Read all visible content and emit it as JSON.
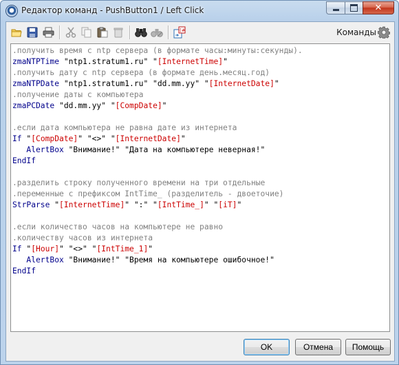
{
  "window": {
    "title": "Редактор команд - PushButton1 / Left Click"
  },
  "toolbar": {
    "icons": [
      "open-folder-icon",
      "save-icon",
      "print-icon",
      "cut-icon",
      "copy-icon",
      "paste-icon",
      "delete-icon",
      "find-icon",
      "find-next-icon",
      "insert-variable-icon"
    ],
    "commands_label": "Команды",
    "commands_icon": "gear-icon"
  },
  "editor": {
    "lines": [
      [
        {
          "t": ".получить время с ntp сервера (в формате часы:минуты:секунды).",
          "c": "comment"
        }
      ],
      [
        {
          "t": "zmaNTPTime",
          "c": "cmd"
        },
        {
          "t": " \"ntp1.stratum1.ru\" ",
          "c": "str"
        },
        {
          "t": "\"",
          "c": "q"
        },
        {
          "t": "[InternetTime]",
          "c": "var"
        },
        {
          "t": "\"",
          "c": "q"
        }
      ],
      [
        {
          "t": ".получить дату с ntp сервера (в формате день.месяц.год)",
          "c": "comment"
        }
      ],
      [
        {
          "t": "zmaNTPDate",
          "c": "cmd"
        },
        {
          "t": " \"ntp1.stratum1.ru\" \"dd.mm.yy\" ",
          "c": "str"
        },
        {
          "t": "\"",
          "c": "q"
        },
        {
          "t": "[InternetDate]",
          "c": "var"
        },
        {
          "t": "\"",
          "c": "q"
        }
      ],
      [
        {
          "t": ".получение даты с компьютера",
          "c": "comment"
        }
      ],
      [
        {
          "t": "zmaPCDate",
          "c": "cmd"
        },
        {
          "t": " \"dd.mm.yy\" ",
          "c": "str"
        },
        {
          "t": "\"",
          "c": "q"
        },
        {
          "t": "[CompDate]",
          "c": "var"
        },
        {
          "t": "\"",
          "c": "q"
        }
      ],
      [],
      [
        {
          "t": ".если дата компьютера не равна дате из интернета",
          "c": "comment"
        }
      ],
      [
        {
          "t": "If",
          "c": "kw"
        },
        {
          "t": " \"",
          "c": "q"
        },
        {
          "t": "[CompDate]",
          "c": "var"
        },
        {
          "t": "\" \"<>\" \"",
          "c": "q"
        },
        {
          "t": "[InternetDate]",
          "c": "var"
        },
        {
          "t": "\"",
          "c": "q"
        }
      ],
      [
        {
          "t": "   AlertBox",
          "c": "cmd"
        },
        {
          "t": " \"Внимание!\" \"Дата на компьютере неверная!\"",
          "c": "str"
        }
      ],
      [
        {
          "t": "EndIf",
          "c": "kw"
        }
      ],
      [],
      [
        {
          "t": ".разделить строку полученного времени на три отдельные",
          "c": "comment"
        }
      ],
      [
        {
          "t": ".переменные с префиксом IntTime_ (разделитель - двоеточие)",
          "c": "comment"
        }
      ],
      [
        {
          "t": "StrParse",
          "c": "cmd"
        },
        {
          "t": " \"",
          "c": "q"
        },
        {
          "t": "[InternetTime]",
          "c": "var"
        },
        {
          "t": "\" \":\" \"",
          "c": "q"
        },
        {
          "t": "[IntTime_]",
          "c": "var"
        },
        {
          "t": "\" \"",
          "c": "q"
        },
        {
          "t": "[iT]",
          "c": "var"
        },
        {
          "t": "\"",
          "c": "q"
        }
      ],
      [],
      [
        {
          "t": ".если количество часов на компьютере не равно",
          "c": "comment"
        }
      ],
      [
        {
          "t": ".количеству часов из интернета",
          "c": "comment"
        }
      ],
      [
        {
          "t": "If",
          "c": "kw"
        },
        {
          "t": " \"",
          "c": "q"
        },
        {
          "t": "[Hour]",
          "c": "var"
        },
        {
          "t": "\" \"<>\" \"",
          "c": "q"
        },
        {
          "t": "[IntTime_1]",
          "c": "var"
        },
        {
          "t": "\"",
          "c": "q"
        }
      ],
      [
        {
          "t": "   AlertBox",
          "c": "cmd"
        },
        {
          "t": " \"Внимание!\" \"Время на компьютере ошибочное!\"",
          "c": "str"
        }
      ],
      [
        {
          "t": "EndIf",
          "c": "kw"
        }
      ]
    ]
  },
  "buttons": {
    "ok_label": "OK",
    "cancel_label": "Отмена",
    "help_label": "Помощь"
  }
}
